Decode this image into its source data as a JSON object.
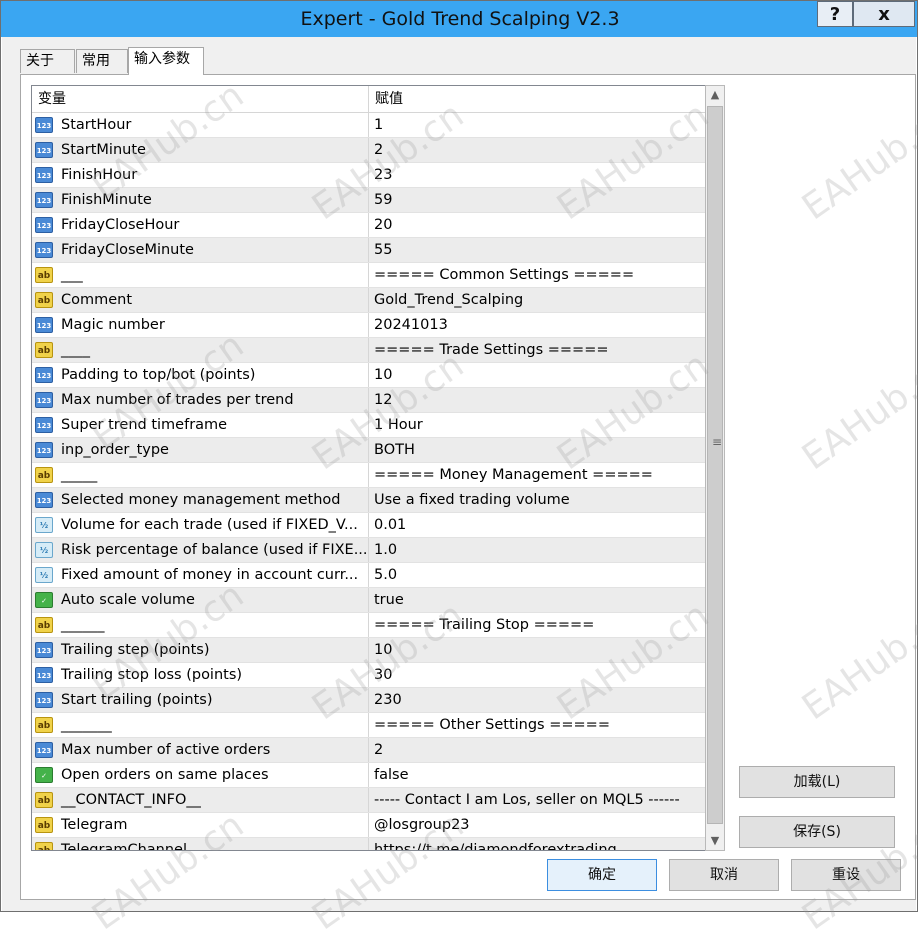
{
  "window": {
    "title": "Expert - Gold Trend Scalping V2.3",
    "help_glyph": "?",
    "close_glyph": "x"
  },
  "tabs": [
    {
      "label": "关于"
    },
    {
      "label": "常用"
    },
    {
      "label": "输入参数"
    }
  ],
  "grid": {
    "col_variable": "变量",
    "col_value": "赋值",
    "rows": [
      {
        "icon": "int",
        "icon_text": "123",
        "name": "StartHour",
        "value": "1"
      },
      {
        "icon": "int",
        "icon_text": "123",
        "name": "StartMinute",
        "value": "2"
      },
      {
        "icon": "int",
        "icon_text": "123",
        "name": "FinishHour",
        "value": "23"
      },
      {
        "icon": "int",
        "icon_text": "123",
        "name": "FinishMinute",
        "value": "59"
      },
      {
        "icon": "int",
        "icon_text": "123",
        "name": "FridayCloseHour",
        "value": "20"
      },
      {
        "icon": "int",
        "icon_text": "123",
        "name": "FridayCloseMinute",
        "value": "55"
      },
      {
        "icon": "str",
        "icon_text": "ab",
        "name": "___",
        "value": "===== Common Settings ====="
      },
      {
        "icon": "str",
        "icon_text": "ab",
        "name": "Comment",
        "value": "Gold_Trend_Scalping"
      },
      {
        "icon": "int",
        "icon_text": "123",
        "name": "Magic number",
        "value": "20241013"
      },
      {
        "icon": "str",
        "icon_text": "ab",
        "name": "____",
        "value": "===== Trade Settings ====="
      },
      {
        "icon": "int",
        "icon_text": "123",
        "name": "Padding to top/bot (points)",
        "value": "10"
      },
      {
        "icon": "int",
        "icon_text": "123",
        "name": "Max number of trades per trend",
        "value": "12"
      },
      {
        "icon": "int",
        "icon_text": "123",
        "name": "Super trend timeframe",
        "value": "1 Hour"
      },
      {
        "icon": "int",
        "icon_text": "123",
        "name": "inp_order_type",
        "value": "BOTH"
      },
      {
        "icon": "str",
        "icon_text": "ab",
        "name": "_____",
        "value": "===== Money Management ====="
      },
      {
        "icon": "int",
        "icon_text": "123",
        "name": "Selected money management method",
        "value": "Use a fixed trading volume"
      },
      {
        "icon": "dbl",
        "icon_text": "½",
        "name": "Volume for each trade (used if FIXED_V...",
        "value": "0.01"
      },
      {
        "icon": "dbl",
        "icon_text": "½",
        "name": "Risk percentage of balance (used if FIXE...",
        "value": "1.0"
      },
      {
        "icon": "dbl",
        "icon_text": "½",
        "name": "Fixed amount of money in account curr...",
        "value": "5.0"
      },
      {
        "icon": "bool",
        "icon_text": "✓",
        "name": "Auto scale volume",
        "value": "true"
      },
      {
        "icon": "str",
        "icon_text": "ab",
        "name": "______",
        "value": "===== Trailing Stop ====="
      },
      {
        "icon": "int",
        "icon_text": "123",
        "name": "Trailing step (points)",
        "value": "10"
      },
      {
        "icon": "int",
        "icon_text": "123",
        "name": "Trailing stop loss (points)",
        "value": "30"
      },
      {
        "icon": "int",
        "icon_text": "123",
        "name": "Start trailing (points)",
        "value": "230"
      },
      {
        "icon": "str",
        "icon_text": "ab",
        "name": "_______",
        "value": "===== Other Settings  ====="
      },
      {
        "icon": "int",
        "icon_text": "123",
        "name": "Max number of active orders",
        "value": "2"
      },
      {
        "icon": "bool",
        "icon_text": "✓",
        "name": "Open orders on same places",
        "value": "false"
      },
      {
        "icon": "str",
        "icon_text": "ab",
        "name": "__CONTACT_INFO__",
        "value": "----- Contact I am Los, seller on MQL5 ------"
      },
      {
        "icon": "str",
        "icon_text": "ab",
        "name": "Telegram",
        "value": "@losgroup23"
      },
      {
        "icon": "str",
        "icon_text": "ab",
        "name": "TelegramChannel",
        "value": "https://t.me/diamondforextrading"
      }
    ]
  },
  "buttons": {
    "load": "加载(L)",
    "save": "保存(S)",
    "ok": "确定",
    "cancel": "取消",
    "reset": "重设"
  },
  "scrollbar": {
    "up_glyph": "▲",
    "down_glyph": "▼",
    "grip_glyph": "≡"
  },
  "watermark_text": "EAHub.cn",
  "colors": {
    "titlebar": "#3aa6f2",
    "row_alt": "#ececec"
  }
}
